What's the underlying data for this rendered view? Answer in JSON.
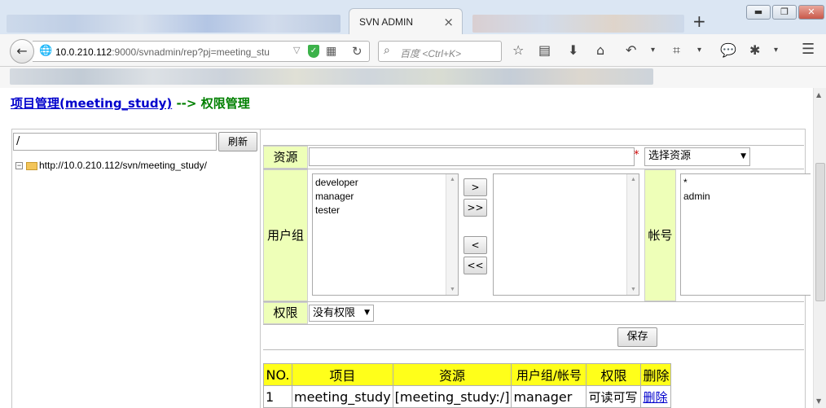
{
  "browser": {
    "tab_title": "SVN ADMIN",
    "tab_close": "×",
    "new_tab": "+",
    "url_host": "10.0.210.112",
    "url_rest": ":9000/svnadmin/rep?pj=meeting_stu",
    "search_placeholder": "百度 <Ctrl+K>",
    "window_minimize": "▬",
    "window_maximize": "❐",
    "window_close": "✕"
  },
  "breadcrumb": {
    "project_link": "项目管理(meeting_study)",
    "separator": "-->",
    "current": "权限管理"
  },
  "left": {
    "path_value": "/",
    "refresh_label": "刷新",
    "tree_root": "http://10.0.210.112/svn/meeting_study/"
  },
  "form": {
    "resource_label": "资源",
    "resource_value": "",
    "required_mark": "*",
    "resource_select": "选择资源",
    "usergroup_label": "用户组",
    "groups": [
      "developer",
      "manager",
      "tester"
    ],
    "btn_add": ">",
    "btn_add_all": ">>",
    "btn_remove": "<",
    "btn_remove_all": "<<",
    "account_label": "帐号",
    "accounts": [
      "*",
      "admin"
    ],
    "permission_label": "权限",
    "permission_value": "没有权限",
    "save_label": "保存"
  },
  "table": {
    "headers": [
      "NO.",
      "项目",
      "资源",
      "用户组/帐号",
      "权限",
      "删除"
    ],
    "rows": [
      {
        "no": "1",
        "project": "meeting_study",
        "resource": "[meeting_study:/]",
        "group": "manager",
        "permission": "可读可写",
        "delete": "删除"
      }
    ]
  },
  "colors": {
    "label_bg": "#eeffb8",
    "table_header_bg": "#ffff1a",
    "link": "#0000cc",
    "crumb_green": "#008000"
  }
}
